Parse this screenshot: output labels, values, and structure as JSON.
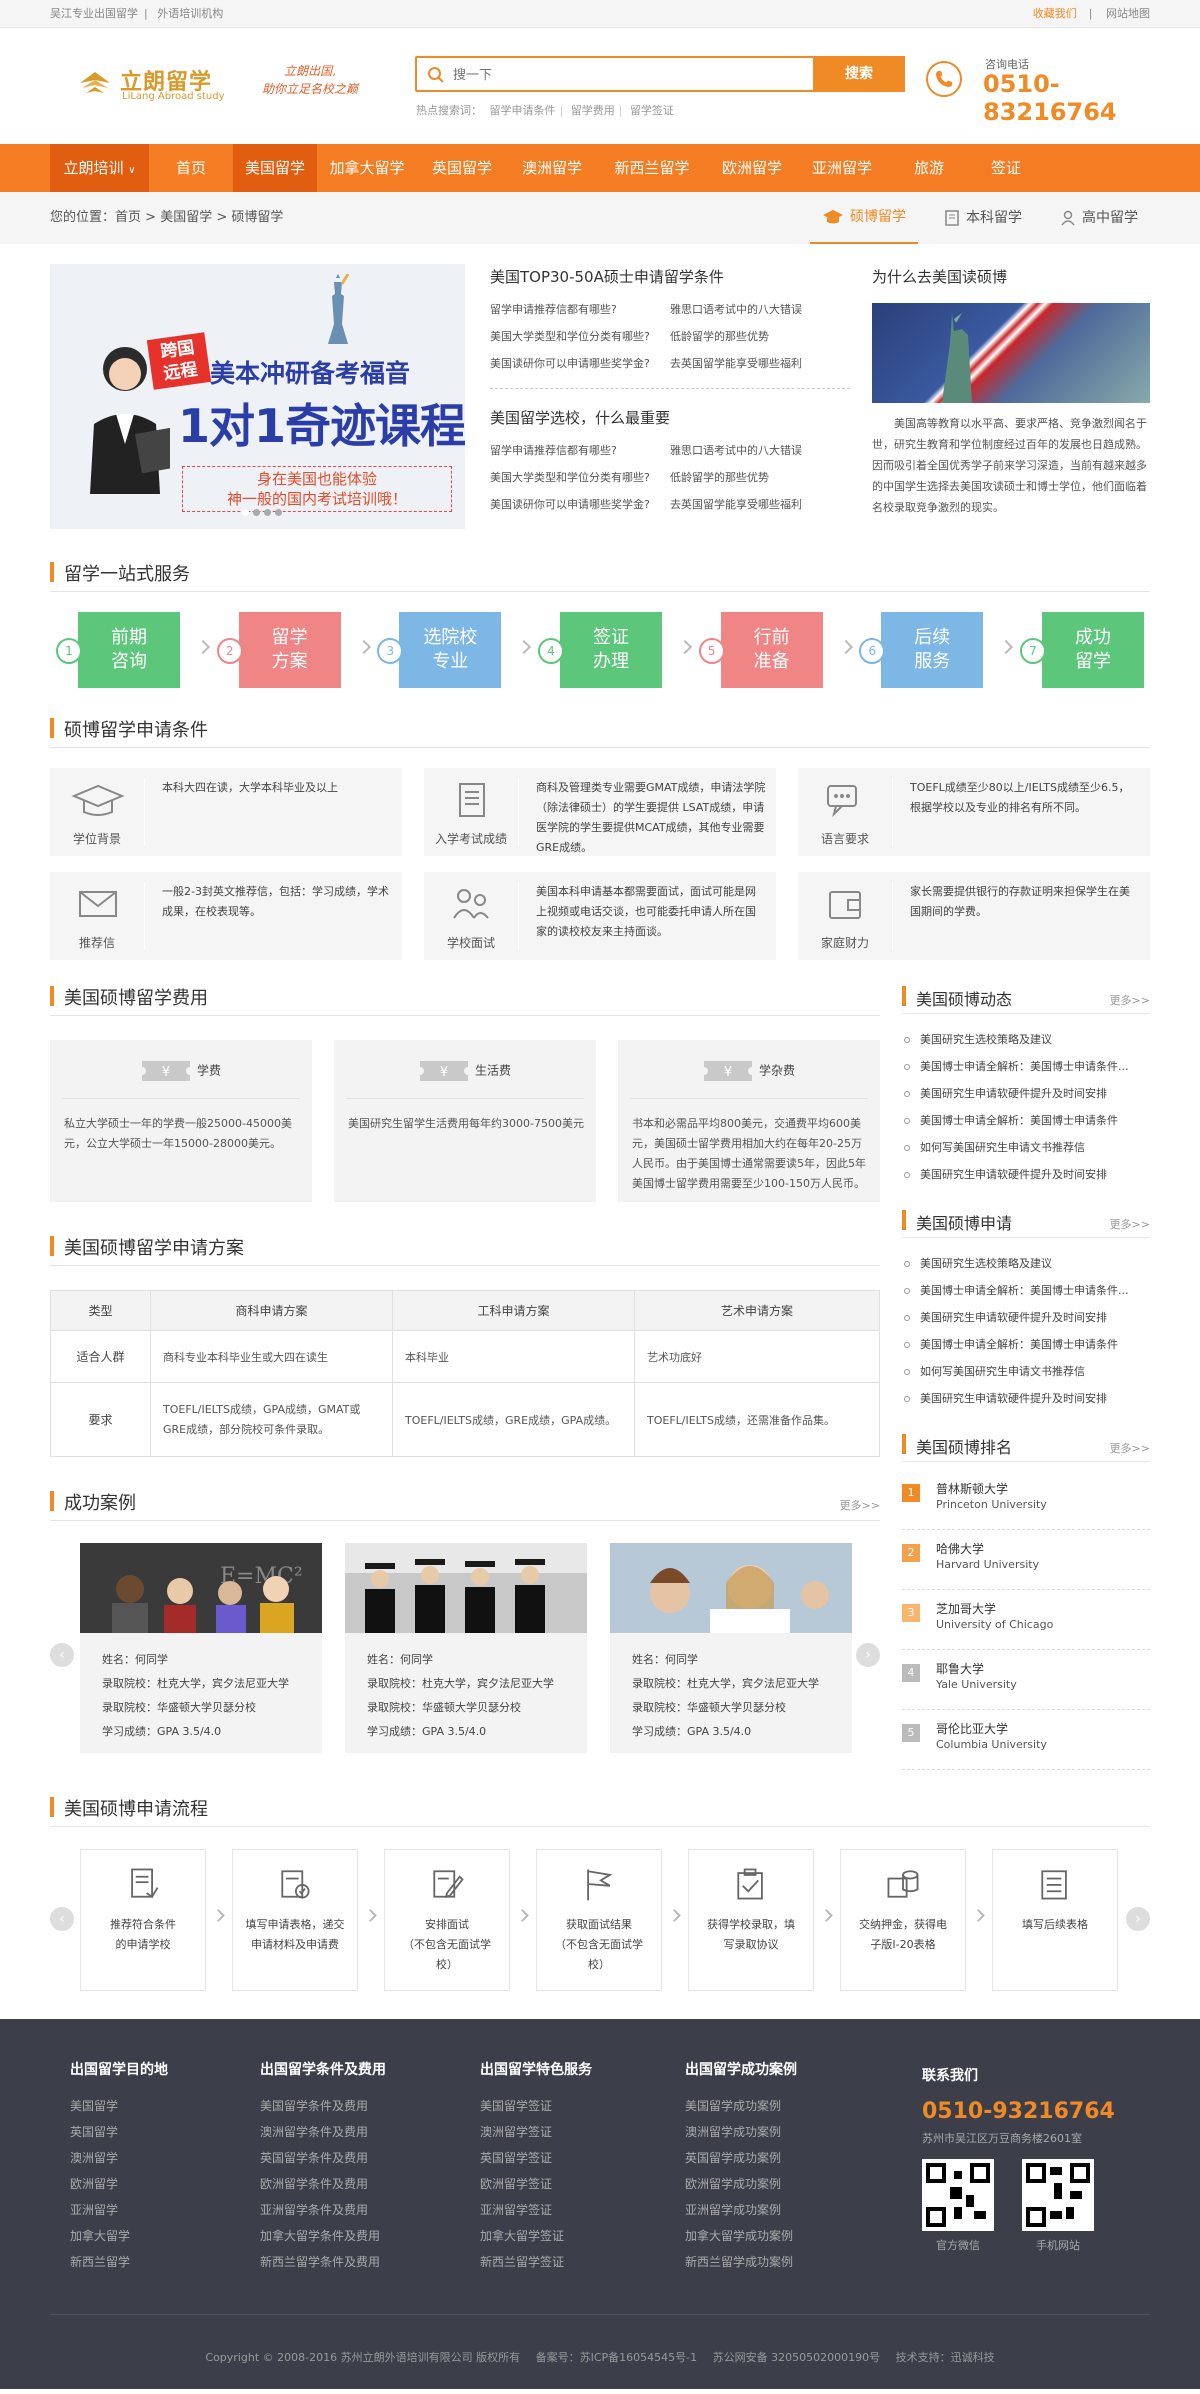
{
  "topbar": {
    "left": [
      "吴江专业出国留学",
      "外语培训机构"
    ],
    "fav": "收藏我们",
    "sitemap": "网站地图"
  },
  "logo": {
    "cn": "立朗留学",
    "en": "LiLang Abroad study",
    "slogan1": "立朗出国,",
    "slogan2": "助你立足名校之巅"
  },
  "search": {
    "placeholder": "搜一下",
    "button": "搜索",
    "hot_label": "热点搜索词：",
    "hot": [
      "留学申请条件",
      "留学费用",
      "留学签证"
    ]
  },
  "phone": {
    "label": "咨询电话",
    "number": "0510-83216764"
  },
  "nav": {
    "first": "立朗培训",
    "items": [
      "首页",
      "美国留学",
      "加拿大留学",
      "英国留学",
      "澳洲留学",
      "新西兰留学",
      "欧洲留学",
      "亚洲留学",
      "旅游",
      "签证"
    ],
    "active": 1
  },
  "crumb": {
    "label": "您的位置：",
    "items": [
      "首页",
      "美国留学",
      "硕博留学"
    ],
    "sep": ">",
    "tabs": [
      "硕博留学",
      "本科留学",
      "高中留学"
    ]
  },
  "banner": {
    "tag1": "跨国",
    "tag2": "远程",
    "t1": "美本冲研备考福音",
    "t2": "1对1奇迹课程",
    "box1": "身在美国也能体验",
    "box2": "神一般的国内考试培训哦！"
  },
  "mid": {
    "title1": "美国TOP30-50A硕士申请留学条件",
    "list1": [
      "留学申请推荐信都有哪些?",
      "雅思口语考试中的八大错误",
      "美国大学类型和学位分类有哪些?",
      "低龄留学的那些优势",
      "美国读研你可以申请哪些奖学金?",
      "去英国留学能享受哪些福利"
    ],
    "title2": "美国留学选校，什么最重要",
    "list2": [
      "留学申请推荐信都有哪些?",
      "雅思口语考试中的八大错误",
      "美国大学类型和学位分类有哪些?",
      "低龄留学的那些优势",
      "美国读研你可以申请哪些奖学金?",
      "去英国留学能享受哪些福利"
    ]
  },
  "why": {
    "title": "为什么去美国读硕博",
    "text": "美国高等教育以水平高、要求严格、竞争激烈闻名于世，研究生教育和学位制度经过百年的发展也日趋成熟。因而吸引着全国优秀学子前来学习深造，当前有越来越多的中国学生选择去美国攻读硕士和博士学位，他们面临着名校录取竞争激烈的现实。"
  },
  "service": {
    "title": "留学一站式服务",
    "steps": [
      {
        "n": "1",
        "a": "前期",
        "b": "咨询",
        "color": "#5cc77a"
      },
      {
        "n": "2",
        "a": "留学",
        "b": "方案",
        "color": "#f08585"
      },
      {
        "n": "3",
        "a": "选院校",
        "b": "专业",
        "color": "#7cb7e6"
      },
      {
        "n": "4",
        "a": "签证",
        "b": "办理",
        "color": "#5cc77a"
      },
      {
        "n": "5",
        "a": "行前",
        "b": "准备",
        "color": "#f08585"
      },
      {
        "n": "6",
        "a": "后续",
        "b": "服务",
        "color": "#7cb7e6"
      },
      {
        "n": "7",
        "a": "成功",
        "b": "留学",
        "color": "#5cc77a"
      }
    ]
  },
  "conds": {
    "title": "硕博留学申请条件",
    "items": [
      {
        "label": "学位背景",
        "icon": "graduation-cap-icon",
        "text": "本科大四在读，大学本科毕业及以上"
      },
      {
        "label": "入学考试成绩",
        "icon": "document-icon",
        "text": "商科及管理类专业需要GMAT成绩，申请法学院（除法律硕士）的学生要提供 LSAT成绩，申请医学院的学生要提供MCAT成绩，其他专业需要GRE成绩。"
      },
      {
        "label": "语言要求",
        "icon": "chat-icon",
        "text": "TOEFL成绩至少80以上/IELTS成绩至少6.5，根据学校以及专业的排名有所不同。"
      },
      {
        "label": "推荐信",
        "icon": "envelope-icon",
        "text": "一般2-3封英文推荐信，包括：学习成绩，学术成果，在校表现等。"
      },
      {
        "label": "学校面试",
        "icon": "interview-icon",
        "text": "美国本科申请基本都需要面试，面试可能是网上视频或电话交谈，也可能委托申请人所在国家的读校校友来主持面谈。"
      },
      {
        "label": "家庭财力",
        "icon": "wallet-icon",
        "text": "家长需要提供银行的存款证明来担保学生在美国期间的学费。"
      }
    ]
  },
  "fees": {
    "title": "美国硕博留学费用",
    "items": [
      {
        "label": "学费",
        "text": "私立大学硕士一年的学费一般25000-45000美元，公立大学硕士一年15000-28000美元。"
      },
      {
        "label": "生活费",
        "text": "美国研究生留学生活费用每年约3000-7500美元"
      },
      {
        "label": "学杂费",
        "text": "书本和必需品平均800美元，交通费平均600美元，美国硕士留学费用相加大约在每年20-25万人民币。由于美国博士通常需要读5年，因此5年美国博士留学费用需要至少100-150万人民币。"
      }
    ]
  },
  "plan": {
    "title": "美国硕博留学申请方案",
    "headers": [
      "类型",
      "商科申请方案",
      "工科申请方案",
      "艺术申请方案"
    ],
    "rows": [
      [
        "适合人群",
        "商科专业本科毕业生或大四在读生",
        "本科毕业",
        "艺术功底好"
      ],
      [
        "要求",
        "TOEFL/IELTS成绩，GPA成绩，GMAT或GRE成绩，部分院校可条件录取。",
        "TOEFL/IELTS成绩，GRE成绩，GPA成绩。",
        "TOEFL/IELTS成绩，还需准备作品集。"
      ]
    ]
  },
  "cases": {
    "title": "成功案例",
    "more": "更多>>",
    "items": [
      {
        "name": "姓名：何同学",
        "school": "录取院校：杜克大学，宾夕法尼亚大学",
        "admit": "录取院校：华盛顿大学贝瑟分校",
        "score": "学习成绩：GPA 3.5/4.0"
      },
      {
        "name": "姓名：何同学",
        "school": "录取院校：杜克大学，宾夕法尼亚大学",
        "admit": "录取院校：华盛顿大学贝瑟分校",
        "score": "学习成绩：GPA 3.5/4.0"
      },
      {
        "name": "姓名：何同学",
        "school": "录取院校：杜克大学，宾夕法尼亚大学",
        "admit": "录取院校：华盛顿大学贝瑟分校",
        "score": "学习成绩：GPA 3.5/4.0"
      }
    ]
  },
  "side": {
    "news": {
      "title": "美国硕博动态",
      "more": "更多>>",
      "items": [
        "美国研究生选校策略及建议",
        "美国博士申请全解析：美国博士申请条件...",
        "美国研究生申请软硬件提升及时间安排",
        "美国博士申请全解析：美国博士申请条件",
        "如何写美国研究生申请文书推荐信",
        "美国研究生申请软硬件提升及时间安排"
      ]
    },
    "apply": {
      "title": "美国硕博申请",
      "more": "更多>>",
      "items": [
        "美国研究生选校策略及建议",
        "美国博士申请全解析：美国博士申请条件...",
        "美国研究生申请软硬件提升及时间安排",
        "美国博士申请全解析：美国博士申请条件",
        "如何写美国研究生申请文书推荐信",
        "美国研究生申请软硬件提升及时间安排"
      ]
    },
    "rank": {
      "title": "美国硕博排名",
      "more": "更多>>",
      "items": [
        {
          "n": "1",
          "cn": "普林斯顿大学",
          "en": "Princeton University",
          "color": "#f08a24"
        },
        {
          "n": "2",
          "cn": "哈佛大学",
          "en": "Harvard University",
          "color": "#f5a04a"
        },
        {
          "n": "3",
          "cn": "芝加哥大学",
          "en": "University of Chicago",
          "color": "#f7b56e"
        },
        {
          "n": "4",
          "cn": "耶鲁大学",
          "en": "Yale University",
          "color": "#bbbbbb"
        },
        {
          "n": "5",
          "cn": "哥伦比亚大学",
          "en": "Columbia University",
          "color": "#bbbbbb"
        }
      ]
    }
  },
  "process": {
    "title": "美国硕博申请流程",
    "items": [
      {
        "a": "推荐符合条件",
        "b": "的申请学校",
        "icon": "list-icon"
      },
      {
        "a": "填写申请表格，递交",
        "b": "申请材料及申请费",
        "icon": "form-icon"
      },
      {
        "a": "安排面试",
        "b": "（不包含无面试学校）",
        "icon": "edit-icon"
      },
      {
        "a": "获取面试结果",
        "b": "（不包含无面试学校）",
        "icon": "flag-icon"
      },
      {
        "a": "获得学校录取，填",
        "b": "写录取协议",
        "icon": "check-icon"
      },
      {
        "a": "交纳押金，获得电",
        "b": "子版I-20表格",
        "icon": "money-icon"
      },
      {
        "a": "填写后续表格",
        "b": "",
        "icon": "notes-icon"
      }
    ]
  },
  "footer": {
    "cols": [
      {
        "title": "出国留学目的地",
        "items": [
          "美国留学",
          "英国留学",
          "澳洲留学",
          "欧洲留学",
          "亚洲留学",
          "加拿大留学",
          "新西兰留学"
        ]
      },
      {
        "title": "出国留学条件及费用",
        "items": [
          "美国留学条件及费用",
          "澳洲留学条件及费用",
          "英国留学条件及费用",
          "欧洲留学条件及费用",
          "亚洲留学条件及费用",
          "加拿大留学条件及费用",
          "新西兰留学条件及费用"
        ]
      },
      {
        "title": "出国留学特色服务",
        "items": [
          "美国留学签证",
          "澳洲留学签证",
          "英国留学签证",
          "欧洲留学签证",
          "亚洲留学签证",
          "加拿大留学签证",
          "新西兰留学签证"
        ]
      },
      {
        "title": "出国留学成功案例",
        "items": [
          "美国留学成功案例",
          "澳洲留学成功案例",
          "英国留学成功案例",
          "欧洲留学成功案例",
          "亚洲留学成功案例",
          "加拿大留学成功案例",
          "新西兰留学成功案例"
        ]
      }
    ],
    "contact": {
      "title": "联系我们",
      "phone": "0510-93216764",
      "address": "苏州市吴江区万豆商务楼2601室",
      "qr1": "官方微信",
      "qr2": "手机网站"
    },
    "copyright": [
      "Copyright © 2008-2016 苏州立朗外语培训有限公司 版权所有",
      "备案号：苏ICP备16054545号-1",
      "苏公网安备 32050502000190号",
      "技术支持：迅诚科技"
    ]
  },
  "colors": {
    "accent": "#f08a24",
    "nav": "#f47c22",
    "nav_active": "#e15d10",
    "footer": "#3c3f4a"
  }
}
